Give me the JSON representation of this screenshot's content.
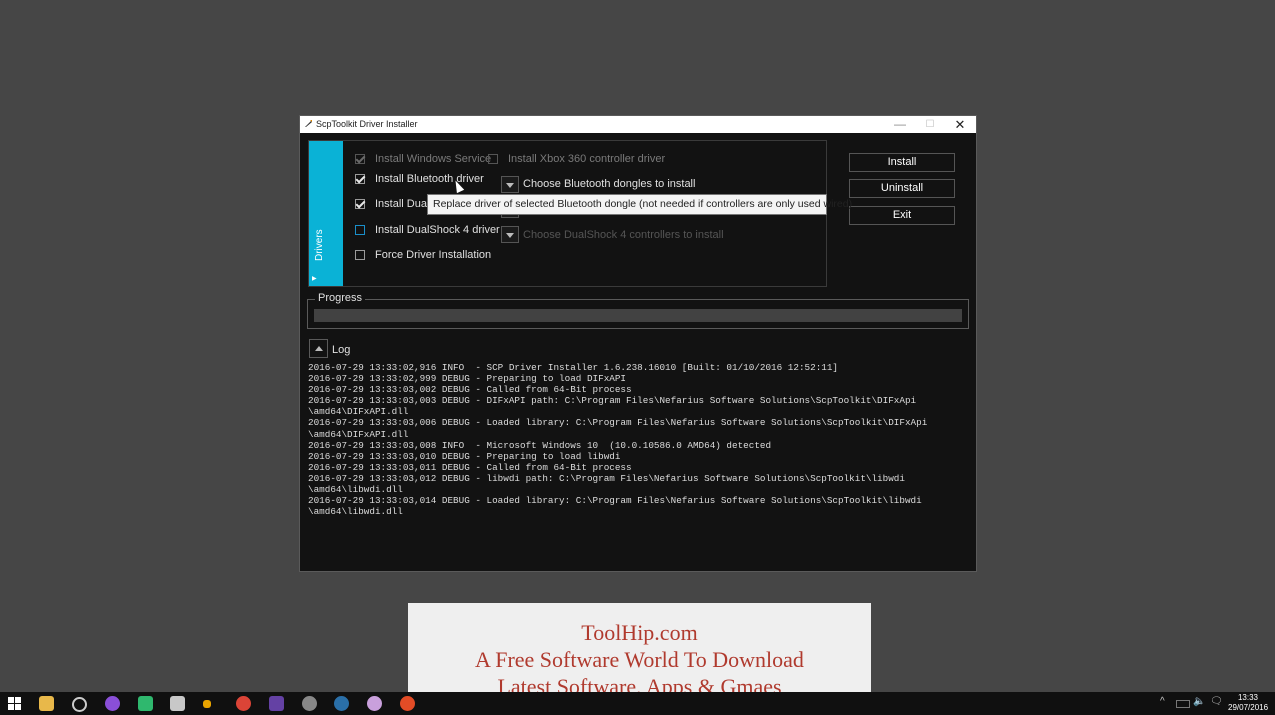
{
  "window": {
    "title": "ScpToolkit Driver Installer",
    "min_glyph": "—",
    "max_glyph": "☐",
    "close_glyph": "✕"
  },
  "drivers": {
    "tab_label": "Drivers",
    "options": {
      "windows_service": {
        "label": "Install Windows Service",
        "checked": true,
        "enabled": false
      },
      "xbox360": {
        "label": "Install Xbox 360 controller driver",
        "checked": false,
        "enabled": false
      },
      "bluetooth": {
        "label": "Install Bluetooth driver",
        "checked": true,
        "enabled": true
      },
      "dualshock3": {
        "label": "Install DualS",
        "checked": true,
        "enabled": true
      },
      "dualshock4": {
        "label": "Install DualShock 4 driver",
        "checked": false,
        "enabled": true
      },
      "force": {
        "label": "Force Driver Installation",
        "checked": false,
        "enabled": true
      }
    },
    "dropdowns": {
      "bluetooth": "Choose Bluetooth dongles to install",
      "dualshock4": "Choose DualShock 4 controllers to install"
    }
  },
  "buttons": {
    "install": "Install",
    "uninstall": "Uninstall",
    "exit": "Exit"
  },
  "progress": {
    "label": "Progress",
    "value": 0
  },
  "log": {
    "label": "Log",
    "text": "2016-07-29 13:33:02,916 INFO  - SCP Driver Installer 1.6.238.16010 [Built: 01/10/2016 12:52:11]\n2016-07-29 13:33:02,999 DEBUG - Preparing to load DIFxAPI\n2016-07-29 13:33:03,002 DEBUG - Called from 64-Bit process\n2016-07-29 13:33:03,003 DEBUG - DIFxAPI path: C:\\Program Files\\Nefarius Software Solutions\\ScpToolkit\\DIFxApi\n\\amd64\\DIFxAPI.dll\n2016-07-29 13:33:03,006 DEBUG - Loaded library: C:\\Program Files\\Nefarius Software Solutions\\ScpToolkit\\DIFxApi\n\\amd64\\DIFxAPI.dll\n2016-07-29 13:33:03,008 INFO  - Microsoft Windows 10  (10.0.10586.0 AMD64) detected\n2016-07-29 13:33:03,010 DEBUG - Preparing to load libwdi\n2016-07-29 13:33:03,011 DEBUG - Called from 64-Bit process\n2016-07-29 13:33:03,012 DEBUG - libwdi path: C:\\Program Files\\Nefarius Software Solutions\\ScpToolkit\\libwdi\n\\amd64\\libwdi.dll\n2016-07-29 13:33:03,014 DEBUG - Loaded library: C:\\Program Files\\Nefarius Software Solutions\\ScpToolkit\\libwdi\n\\amd64\\libwdi.dll"
  },
  "tooltip": {
    "text": "Replace driver of selected Bluetooth dongle (not needed if controllers are only used wired)"
  },
  "watermark": {
    "line1": "ToolHip.com",
    "line2": "A Free Software World To Download",
    "line3": "Latest Software, Apps & Gmaes"
  },
  "taskbar": {
    "icons": [
      "windows-start-icon",
      "file-explorer-icon",
      "settings-icon",
      "purple-app-icon",
      "green-app-icon",
      "calculator-icon",
      "taskbar-app-icon",
      "chrome-icon",
      "twitch-icon",
      "steam-tool-icon",
      "steam-icon",
      "discord-icon",
      "red-app-icon"
    ],
    "tray_glyphs": {
      "chevron": "^",
      "volume": "🔈",
      "notifications": "🗨"
    },
    "time": "13:33",
    "date": "29/07/2016"
  }
}
